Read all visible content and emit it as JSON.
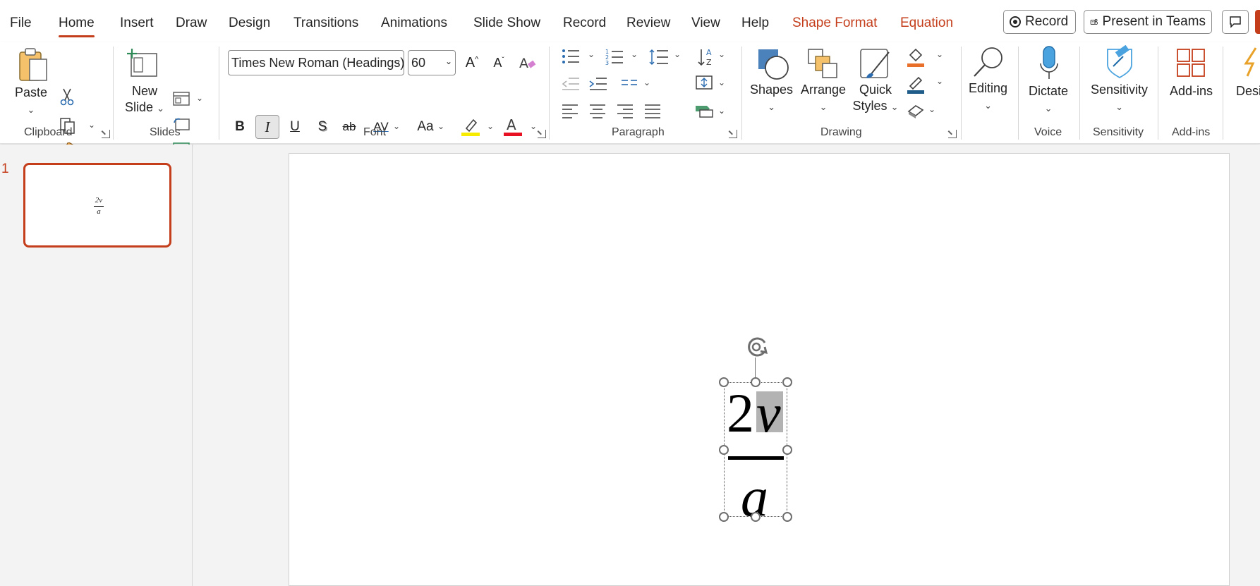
{
  "menu": {
    "tabs": [
      "File",
      "Home",
      "Insert",
      "Draw",
      "Design",
      "Transitions",
      "Animations",
      "Slide Show",
      "Record",
      "Review",
      "View",
      "Help",
      "Shape Format",
      "Equation"
    ],
    "record_btn": "Record",
    "present_btn": "Present in Teams"
  },
  "ribbon": {
    "clipboard": {
      "paste": "Paste",
      "group": "Clipboard"
    },
    "slides": {
      "new_slide_line1": "New",
      "new_slide_line2": "Slide",
      "group": "Slides"
    },
    "font": {
      "font_name": "Times New Roman (Headings)",
      "font_size": "60",
      "bold": "B",
      "italic": "I",
      "underline": "U",
      "shadow": "S",
      "strike": "ab",
      "spacing": "AV",
      "case": "Aa",
      "group": "Font"
    },
    "paragraph": {
      "group": "Paragraph"
    },
    "drawing": {
      "shapes": "Shapes",
      "arrange": "Arrange",
      "quick_line1": "Quick",
      "quick_line2": "Styles",
      "group": "Drawing"
    },
    "editing": {
      "label": "Editing"
    },
    "voice": {
      "dictate": "Dictate",
      "group": "Voice"
    },
    "sensitivity": {
      "label": "Sensitivity",
      "group": "Sensitivity"
    },
    "addins": {
      "label": "Add-ins",
      "group": "Add-ins"
    },
    "designer": {
      "label": "Desi"
    }
  },
  "thumbnails": {
    "slide_number": "1",
    "thumb_numerator": "2v",
    "thumb_denominator": "a"
  },
  "equation": {
    "numerator_digit": "2",
    "numerator_var": "v",
    "denominator": "a"
  },
  "colors": {
    "accent": "#c43e1c",
    "highlight": "#b3b3b3"
  }
}
